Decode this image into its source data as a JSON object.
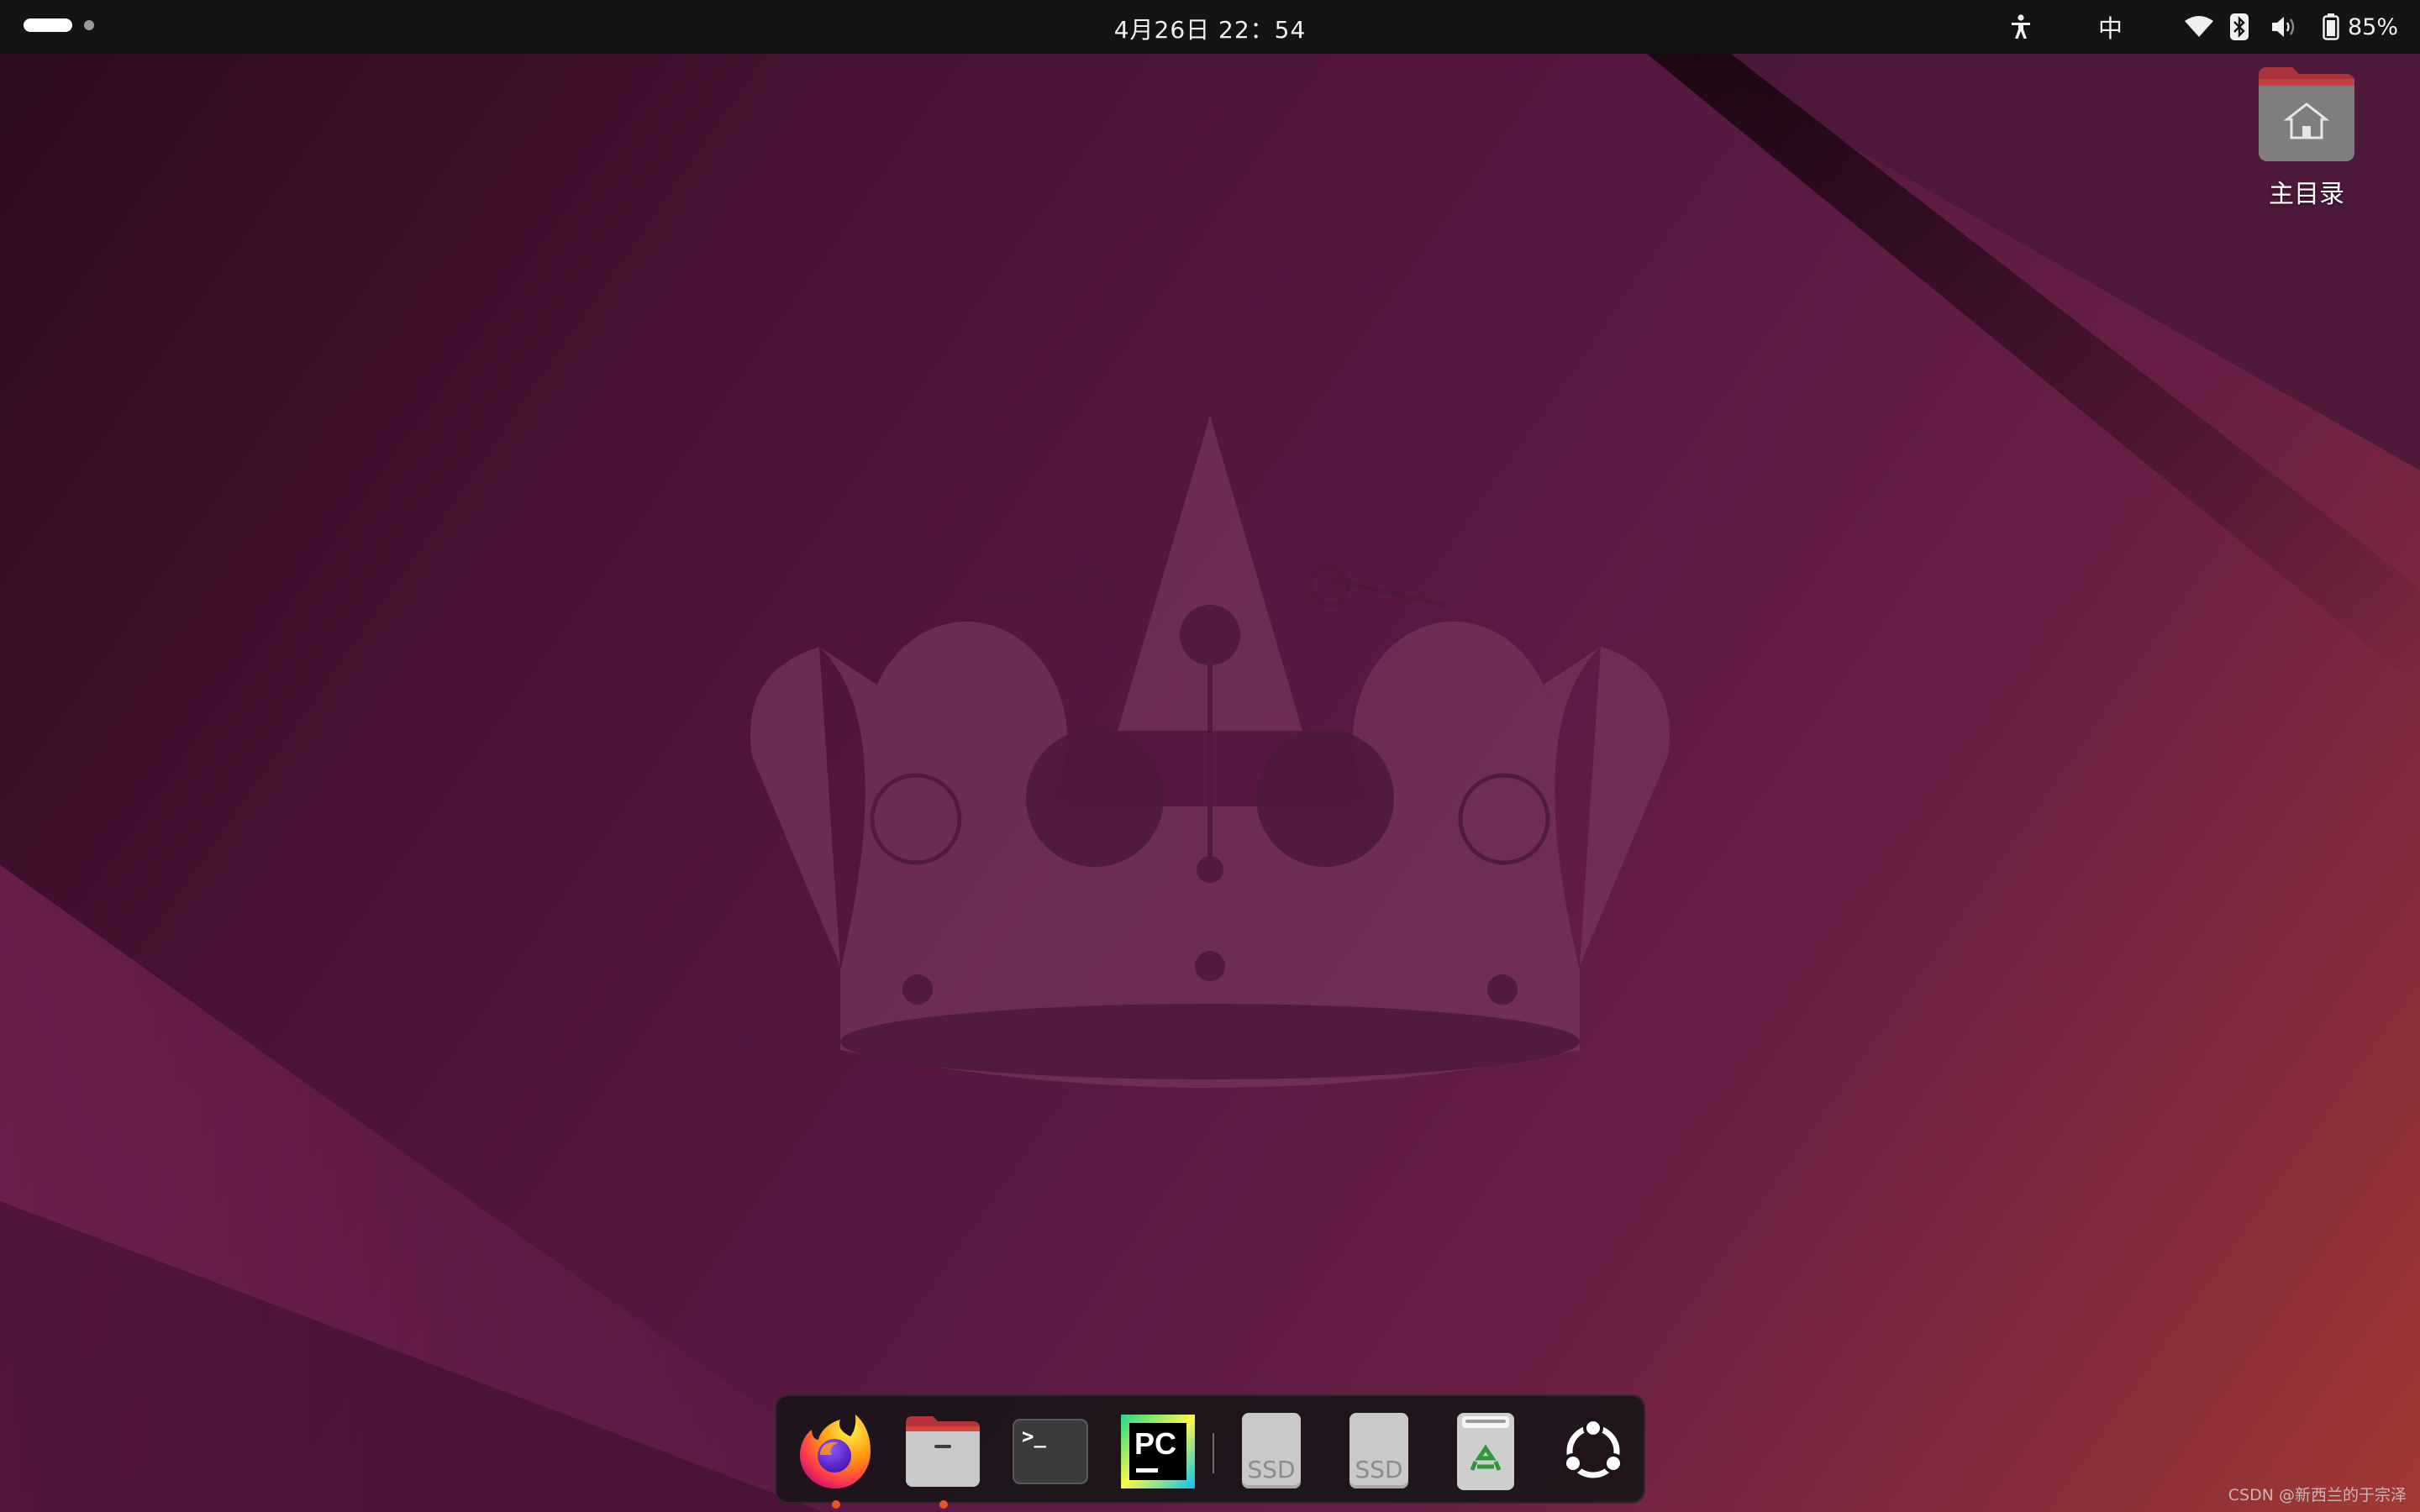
{
  "topbar": {
    "clock": "4月26日  22：54",
    "input_method": "中",
    "battery_level": "85%",
    "icons": [
      "activities-indicator",
      "accessibility-icon",
      "wifi-icon",
      "bluetooth-icon",
      "volume-icon",
      "battery-icon"
    ]
  },
  "desktop": {
    "home_folder_label": "主目录"
  },
  "dock": {
    "apps": [
      {
        "name": "Firefox",
        "icon": "firefox-icon",
        "running": true
      },
      {
        "name": "Files",
        "icon": "files-icon",
        "running": true
      },
      {
        "name": "Terminal",
        "icon": "terminal-icon",
        "running": false
      },
      {
        "name": "PyCharm",
        "icon": "pycharm-icon",
        "running": false,
        "icon_text": "PC"
      },
      {
        "name": "SSD",
        "icon": "ssd-drive-icon",
        "running": false,
        "icon_text": "SSD"
      },
      {
        "name": "SSD",
        "icon": "ssd-drive-icon",
        "running": false,
        "icon_text": "SSD"
      },
      {
        "name": "Trash",
        "icon": "trash-icon",
        "running": false
      },
      {
        "name": "Show Apps",
        "icon": "show-apps-icon",
        "running": false
      }
    ],
    "terminal_prompt": ">_"
  },
  "watermark": "CSDN @新西兰的于宗泽",
  "colors": {
    "topbar": "#141414",
    "dock": "#1c141a",
    "accent": "#e95420",
    "wallpaper_dark": "#2c0a1d",
    "wallpaper_mid": "#5a1a42",
    "wallpaper_warm": "#a23a32"
  }
}
